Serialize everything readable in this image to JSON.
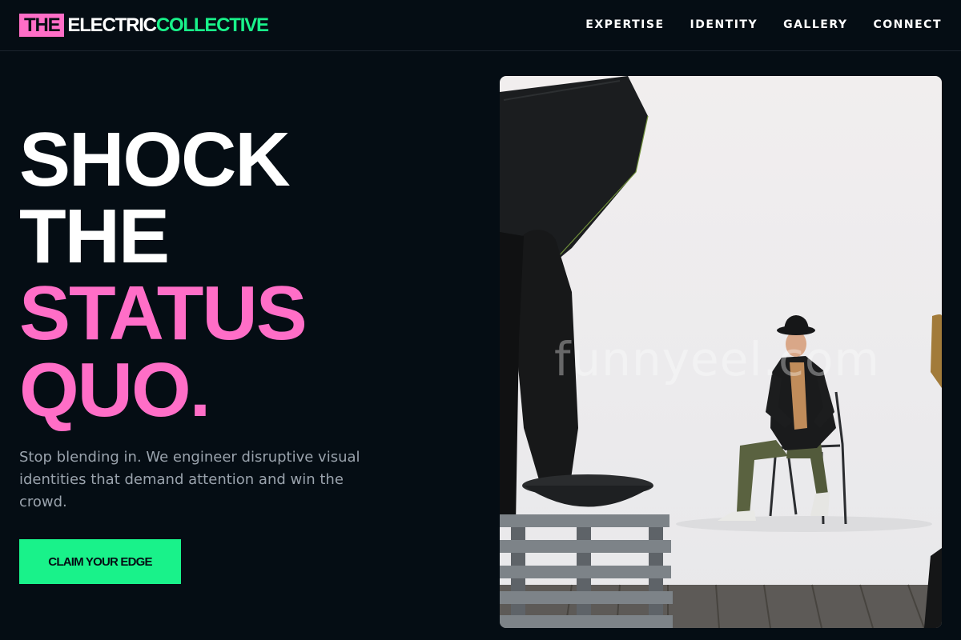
{
  "brand": {
    "part1": "THE",
    "part2": "ELECTRIC",
    "part3": "COLLECTIVE",
    "colors": {
      "pink": "#ff6ec7",
      "green": "#19f28a",
      "background": "#050d14"
    }
  },
  "nav": {
    "items": [
      {
        "label": "EXPERTISE"
      },
      {
        "label": "IDENTITY"
      },
      {
        "label": "GALLERY"
      },
      {
        "label": "CONNECT"
      }
    ]
  },
  "hero": {
    "headline": {
      "line1": "SHOCK",
      "line2": "THE",
      "line3": "STATUS",
      "line4": "QUO."
    },
    "subtext": "Stop blending in. We engineer disruptive visual identities that demand attention and win the crowd.",
    "cta_label": "CLAIM YOUR EDGE",
    "image": {
      "watermark": "funnyeel.com"
    }
  }
}
